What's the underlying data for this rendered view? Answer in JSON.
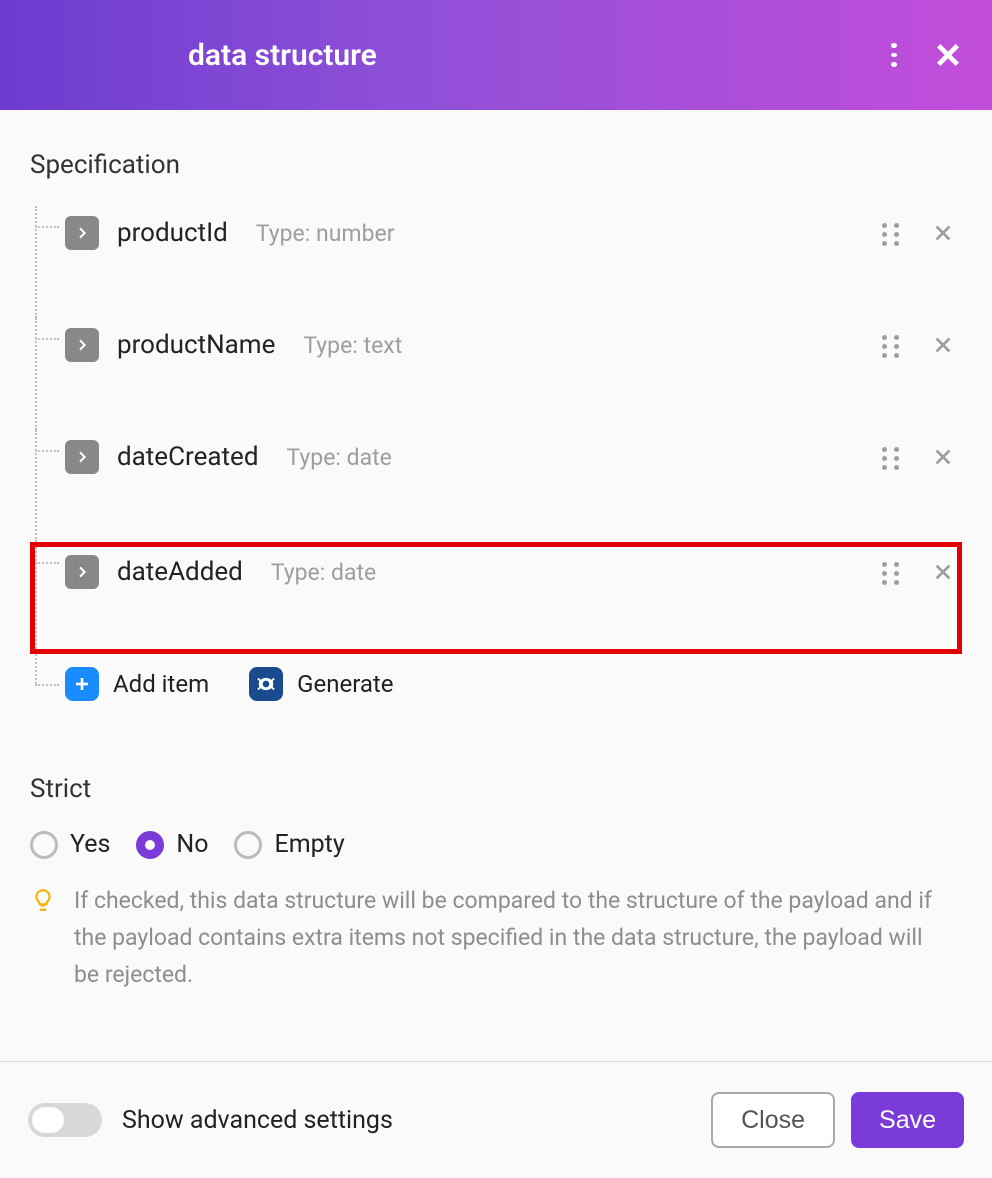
{
  "header": {
    "title": "data structure"
  },
  "specification": {
    "label": "Specification",
    "items": [
      {
        "name": "productId",
        "type_label": "Type: number",
        "highlighted": false
      },
      {
        "name": "productName",
        "type_label": "Type: text",
        "highlighted": false
      },
      {
        "name": "dateCreated",
        "type_label": "Type: date",
        "highlighted": false
      },
      {
        "name": "dateAdded",
        "type_label": "Type: date",
        "highlighted": true
      }
    ],
    "add_item_label": "Add item",
    "generate_label": "Generate"
  },
  "strict": {
    "label": "Strict",
    "options": [
      {
        "label": "Yes",
        "selected": false
      },
      {
        "label": "No",
        "selected": true
      },
      {
        "label": "Empty",
        "selected": false
      }
    ],
    "hint": "If checked, this data structure will be compared to the structure of the payload and if the payload contains extra items not specified in the data structure, the payload will be rejected."
  },
  "footer": {
    "advanced_label": "Show advanced settings",
    "close_label": "Close",
    "save_label": "Save"
  }
}
